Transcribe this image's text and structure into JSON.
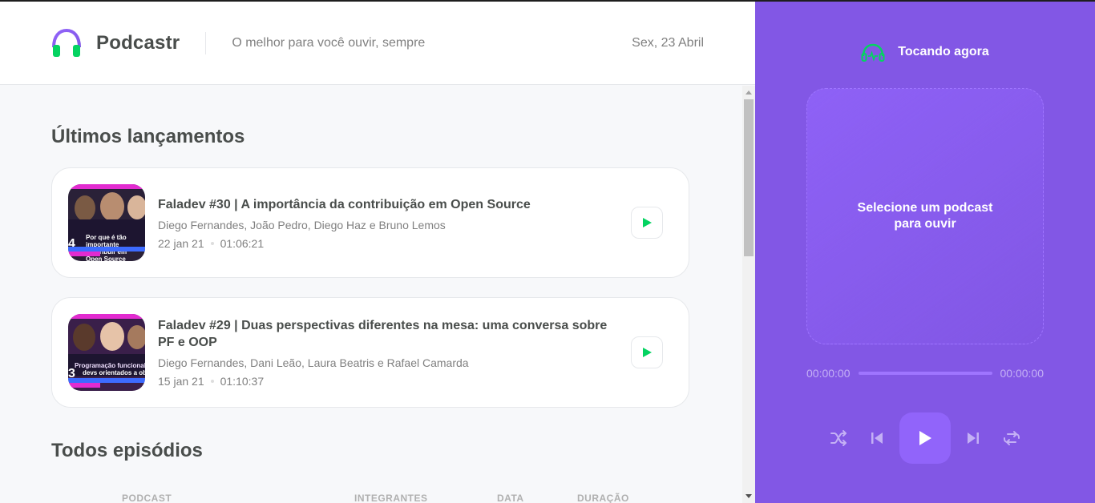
{
  "header": {
    "logo_text": "Podcastr",
    "tagline": "O melhor para você ouvir, sempre",
    "date": "Sex, 23 Abril"
  },
  "latest": {
    "title": "Últimos lançamentos",
    "episodes": [
      {
        "title": "Faladev #30 | A importância da contribuição em Open Source",
        "members": "Diego Fernandes, João Pedro, Diego Haz e Bruno Lemos",
        "published": "22 jan 21",
        "duration": "01:06:21",
        "thumb_caption": "Por que é tão importante contribuir em Open Source",
        "thumb_number": "4"
      },
      {
        "title": "Faladev #29 | Duas perspectivas diferentes na mesa: uma conversa sobre PF e OOP",
        "members": "Diego Fernandes, Dani Leão, Laura Beatris e Rafael Camarda",
        "published": "15 jan 21",
        "duration": "01:10:37",
        "thumb_caption_small": "Programação funcional",
        "thumb_caption": "devs orientados a objetos",
        "thumb_number": "3"
      }
    ]
  },
  "all": {
    "title": "Todos episódios",
    "columns": [
      "PODCAST",
      "INTEGRANTES",
      "DATA",
      "DURAÇÃO"
    ]
  },
  "player": {
    "heading": "Tocando agora",
    "empty_text": "Selecione um podcast para ouvir",
    "time_current": "00:00:00",
    "time_total": "00:00:00",
    "progress": 0
  },
  "colors": {
    "brand": "#8257e5",
    "accent_green": "#04d361",
    "text_dark": "#494d4b",
    "text_muted": "#808080"
  }
}
